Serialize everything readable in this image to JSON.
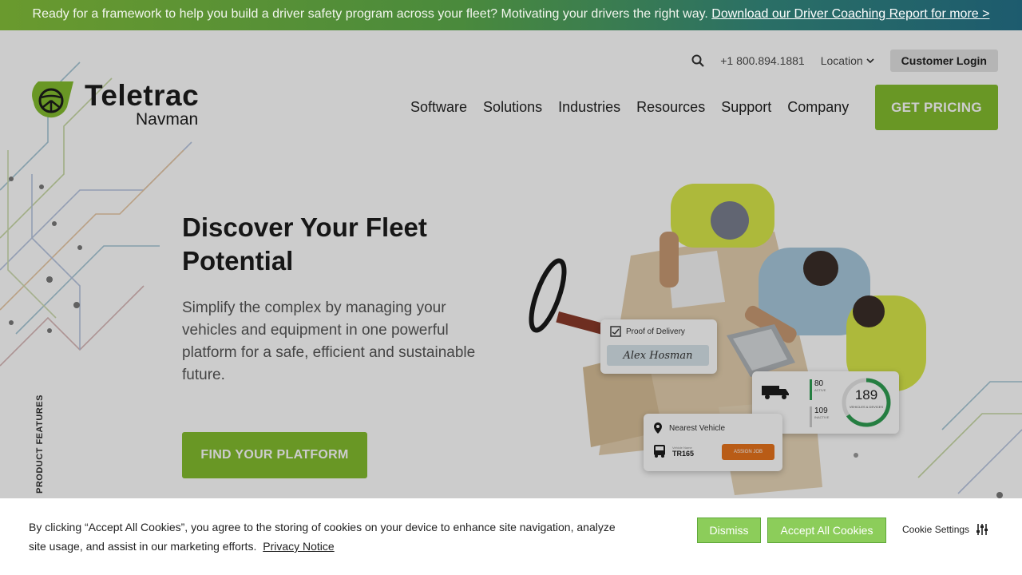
{
  "banner": {
    "text": "Ready for a framework to help you build a driver safety program across your fleet? Motivating your drivers the right way.",
    "link": "Download our Driver Coaching Report for more >"
  },
  "utility": {
    "phone": "+1 800.894.1881",
    "location": "Location",
    "login": "Customer Login"
  },
  "logo": {
    "line1": "Teletrac",
    "line2": "Navman"
  },
  "nav": {
    "items": [
      "Software",
      "Solutions",
      "Industries",
      "Resources",
      "Support",
      "Company"
    ],
    "cta": "GET PRICING"
  },
  "hero": {
    "title": "Discover Your Fleet Potential",
    "subtitle": "Simplify the complex by managing your vehicles and equipment in one powerful platform for a safe, efficient and sustainable future.",
    "cta": "FIND YOUR PLATFORM",
    "side_label": "PRODUCT FEATURES"
  },
  "cards": {
    "pod_title": "Proof of Delivery",
    "signature": "Alex Hosman",
    "active_count": "80",
    "active_label": "ACTIVE",
    "inactive_count": "109",
    "inactive_label": "INACTIVE",
    "total": "189",
    "total_label": "VEHICLES & DEVICES",
    "nearest_title": "Nearest Vehicle",
    "vehicle_small": "Vehicle Name",
    "vehicle_id": "TR165",
    "assign": "ASSIGN JOB"
  },
  "cookie": {
    "message": "By clicking “Accept All Cookies”, you agree to the storing of cookies on your device to enhance site navigation, analyze site usage, and assist in our marketing efforts.",
    "privacy": "Privacy Notice",
    "dismiss": "Dismiss",
    "accept": "Accept All Cookies",
    "settings": "Cookie Settings"
  },
  "colors": {
    "brand_green": "#84bd2f",
    "cookie_green": "#8ccd5a",
    "orange": "#e8731c"
  }
}
